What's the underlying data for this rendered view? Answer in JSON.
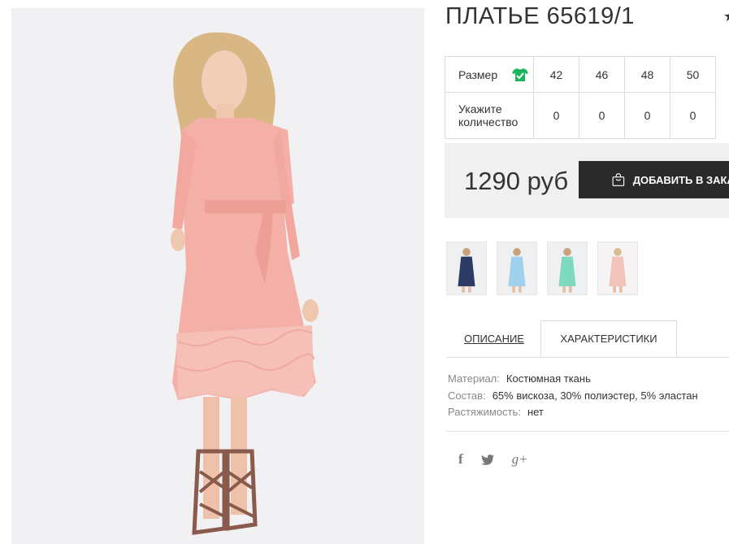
{
  "product": {
    "title": "ПЛАТЬЕ 65619/1",
    "star": "★"
  },
  "sizes": {
    "size_label": "Размер",
    "qty_label_line1": "Укажите",
    "qty_label_line2": "количество",
    "values": [
      "42",
      "46",
      "48",
      "50"
    ],
    "quantities": [
      "0",
      "0",
      "0",
      "0"
    ]
  },
  "price": {
    "amount": "1290 руб",
    "add_label": "ДОБАВИТЬ В ЗАКАЗ"
  },
  "thumbnails": [
    {
      "name": "thumb-navy",
      "color": "#2c3b63"
    },
    {
      "name": "thumb-blue",
      "color": "#9fd0ec"
    },
    {
      "name": "thumb-mint",
      "color": "#7ed9c0"
    },
    {
      "name": "thumb-pink",
      "color": "#f2c3ba"
    }
  ],
  "tabs": {
    "description": "ОПИСАНИЕ",
    "characteristics": "ХАРАКТЕРИСТИКИ"
  },
  "specs": [
    {
      "key": "Материал:",
      "value": "Костюмная ткань"
    },
    {
      "key": "Состав:",
      "value": "65% вискоза, 30% полиэстер, 5% эластан"
    },
    {
      "key": "Растяжимость:",
      "value": "нет"
    }
  ],
  "social": {
    "facebook": "f",
    "twitter": "🐦",
    "googleplus": "g+"
  },
  "colors": {
    "dress": "#f4b0a7",
    "dark_button": "#2a2a2a",
    "price_bg": "#f0f0f0",
    "size_icon": "#1bb35c"
  }
}
